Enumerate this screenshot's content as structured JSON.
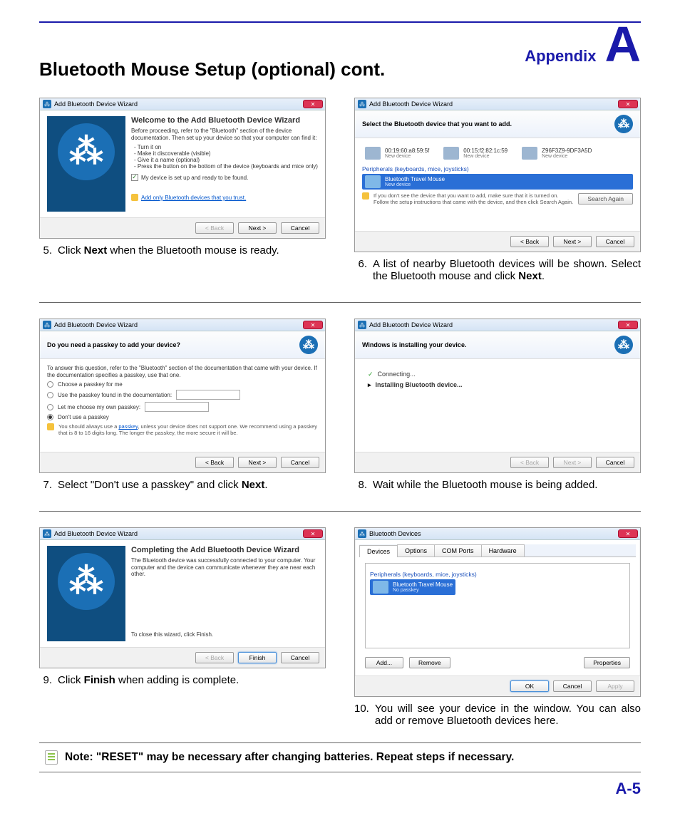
{
  "header": {
    "label": "Appendix",
    "letter": "A"
  },
  "title": "Bluetooth Mouse Setup (optional) cont.",
  "page_number": "A-5",
  "note": "Note: \"RESET\" may be necessary after changing batteries. Repeat steps if necessary.",
  "steps": {
    "s5": {
      "num": "5.",
      "txt": "Click <b>Next</b> when the Bluetooth mouse is ready.",
      "dlg": {
        "title": "Add Bluetooth Device Wizard",
        "heading": "Welcome to the Add Bluetooth Device Wizard",
        "intro": "Before proceeding, refer to the \"Bluetooth\" section of the device documentation. Then set up your device so that your computer can find it:",
        "bullets": [
          "Turn it on",
          "Make it discoverable (visible)",
          "Give it a name (optional)",
          "Press the button on the bottom of the device (keyboards and mice only)"
        ],
        "checkbox": "My device is set up and ready to be found.",
        "link": "Add only Bluetooth devices that you trust.",
        "buttons": {
          "back": "< Back",
          "next": "Next >",
          "cancel": "Cancel"
        }
      }
    },
    "s6": {
      "num": "6.",
      "txt": "A list of nearby Bluetooth devices will be shown. Select the Bluetooth mouse and click <b>Next</b>.",
      "dlg": {
        "title": "Add Bluetooth Device Wizard",
        "header": "Select the Bluetooth device that you want to add.",
        "devices": [
          {
            "name": "00:19:60:a8:59:5f",
            "sub": "New device"
          },
          {
            "name": "00:15:f2:82:1c:59",
            "sub": "New device"
          },
          {
            "name": "Z96F3Z9-9DF3A5D",
            "sub": "New device"
          }
        ],
        "group": "Peripherals (keyboards, mice, joysticks)",
        "selected": {
          "name": "Bluetooth Travel Mouse",
          "sub": "New device"
        },
        "info": "If you don't see the device that you want to add, make sure that it is turned on. Follow the setup instructions that came with the device, and then click Search Again.",
        "search": "Search Again",
        "buttons": {
          "back": "< Back",
          "next": "Next >",
          "cancel": "Cancel"
        }
      }
    },
    "s7": {
      "num": "7.",
      "txt": "Select \"Don't use a passkey\" and click <b>Next</b>.",
      "dlg": {
        "title": "Add Bluetooth Device Wizard",
        "header": "Do you need a passkey to add your device?",
        "intro": "To answer this question, refer to the \"Bluetooth\" section of the documentation that came with your device. If the documentation specifies a passkey, use that one.",
        "radios": {
          "r1": "Choose a passkey for me",
          "r2": "Use the passkey found in the documentation:",
          "r3": "Let me choose my own passkey:",
          "r4": "Don't use a passkey"
        },
        "hint_link": "passkey",
        "hint": "You should always use a passkey, unless your device does not support one. We recommend using a passkey that is 8 to 16 digits long. The longer the passkey, the more secure it will be.",
        "buttons": {
          "back": "< Back",
          "next": "Next >",
          "cancel": "Cancel"
        }
      }
    },
    "s8": {
      "num": "8.",
      "txt": "Wait while the Bluetooth mouse is being added.",
      "dlg": {
        "title": "Add Bluetooth Device Wizard",
        "header": "Windows is installing your device.",
        "items": {
          "connecting": "Connecting...",
          "installing": "Installing Bluetooth device..."
        },
        "buttons": {
          "back": "< Back",
          "next": "Next >",
          "cancel": "Cancel"
        }
      }
    },
    "s9": {
      "num": "9.",
      "txt": "Click <b>Finish</b> when adding is complete.",
      "dlg": {
        "title": "Add Bluetooth Device Wizard",
        "heading": "Completing the Add Bluetooth Device Wizard",
        "intro": "The Bluetooth device was successfully connected to your computer. Your computer and the device can communicate whenever they are near each other.",
        "closing": "To close this wizard, click Finish.",
        "buttons": {
          "back": "< Back",
          "finish": "Finish",
          "cancel": "Cancel"
        }
      }
    },
    "s10": {
      "num": "10.",
      "txt": "You will see your device in the window. You can also add or remove Bluetooth devices here.",
      "dlg": {
        "title": "Bluetooth Devices",
        "tabs": [
          "Devices",
          "Options",
          "COM Ports",
          "Hardware"
        ],
        "group": "Peripherals (keyboards, mice, joysticks)",
        "selected": {
          "name": "Bluetooth Travel Mouse",
          "sub": "No passkey"
        },
        "row_buttons": {
          "add": "Add...",
          "remove": "Remove",
          "props": "Properties"
        },
        "buttons": {
          "ok": "OK",
          "cancel": "Cancel",
          "apply": "Apply"
        }
      }
    }
  }
}
